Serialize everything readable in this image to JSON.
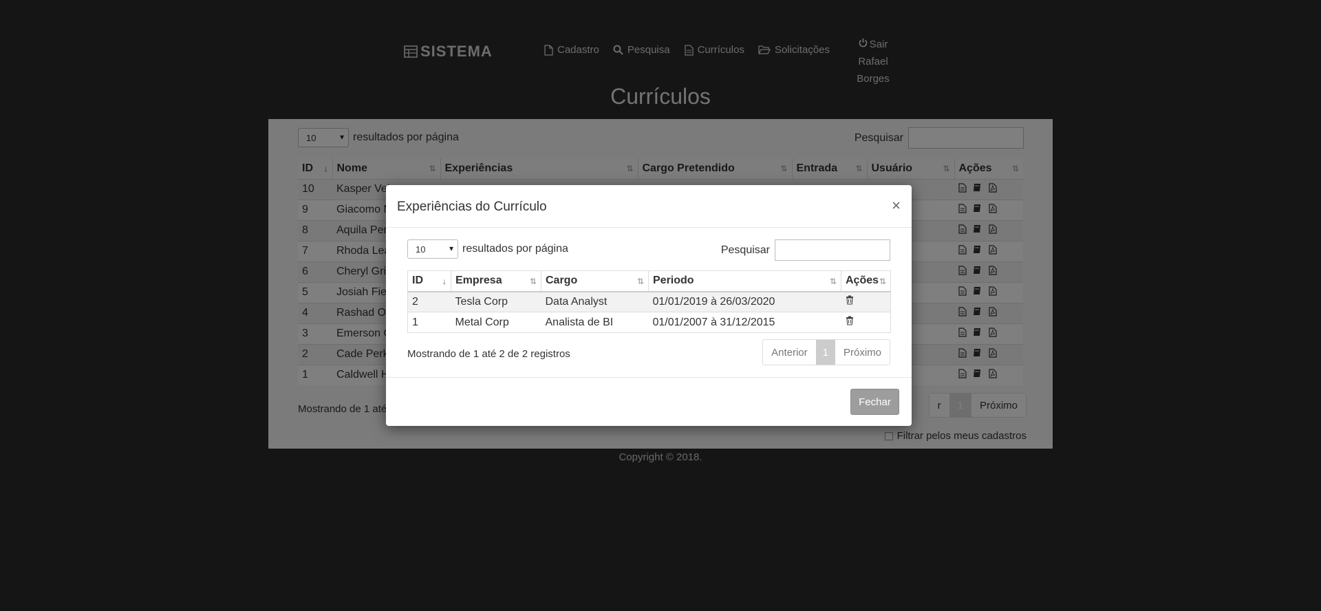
{
  "brand": {
    "name": "SISTEMA",
    "icon": "grid-icon"
  },
  "nav": {
    "items": [
      {
        "label": "Cadastro",
        "icon": "file-icon"
      },
      {
        "label": "Pesquisa",
        "icon": "search-icon"
      },
      {
        "label": "Currículos",
        "icon": "document-icon"
      },
      {
        "label": "Solicitações",
        "icon": "folder-open-icon"
      }
    ],
    "logout_label": "Sair",
    "user_name": "Rafael Borges"
  },
  "page": {
    "title": "Currículos"
  },
  "main_table": {
    "length_value": "10",
    "length_label": "resultados por página",
    "search_label": "Pesquisar",
    "columns": [
      "ID",
      "Nome",
      "Experiências",
      "Cargo Pretendido",
      "Entrada",
      "Usuário",
      "Ações"
    ],
    "rows": [
      {
        "id": "10",
        "name": "Kasper Vel"
      },
      {
        "id": "9",
        "name": "Giacomo M"
      },
      {
        "id": "8",
        "name": "Aquila Per"
      },
      {
        "id": "7",
        "name": "Rhoda Lea"
      },
      {
        "id": "6",
        "name": "Cheryl Gri"
      },
      {
        "id": "5",
        "name": "Josiah Fiel"
      },
      {
        "id": "4",
        "name": "Rashad Oc"
      },
      {
        "id": "3",
        "name": "Emerson C"
      },
      {
        "id": "2",
        "name": "Cade Perki"
      },
      {
        "id": "1",
        "name": "Caldwell H"
      }
    ],
    "info": "Mostrando de 1 até",
    "pager": {
      "prev_partial": "r",
      "current": "1",
      "next": "Próximo"
    },
    "filter_label": "Filtrar pelos meus cadastros"
  },
  "copyright": "Copyright © 2018.",
  "modal": {
    "title": "Experiências do Currículo",
    "close_label": "×",
    "length_value": "10",
    "length_label": "resultados por página",
    "search_label": "Pesquisar",
    "columns": [
      "ID",
      "Empresa",
      "Cargo",
      "Periodo",
      "Ações"
    ],
    "rows": [
      {
        "id": "2",
        "empresa": "Tesla Corp",
        "cargo": "Data Analyst",
        "periodo": "01/01/2019 à 26/03/2020"
      },
      {
        "id": "1",
        "empresa": "Metal Corp",
        "cargo": "Analista de BI",
        "periodo": "01/01/2007 à 31/12/2015"
      }
    ],
    "info": "Mostrando de 1 até 2 de 2 registros",
    "pager": {
      "prev": "Anterior",
      "current": "1",
      "next": "Próximo"
    },
    "close_button": "Fechar"
  }
}
